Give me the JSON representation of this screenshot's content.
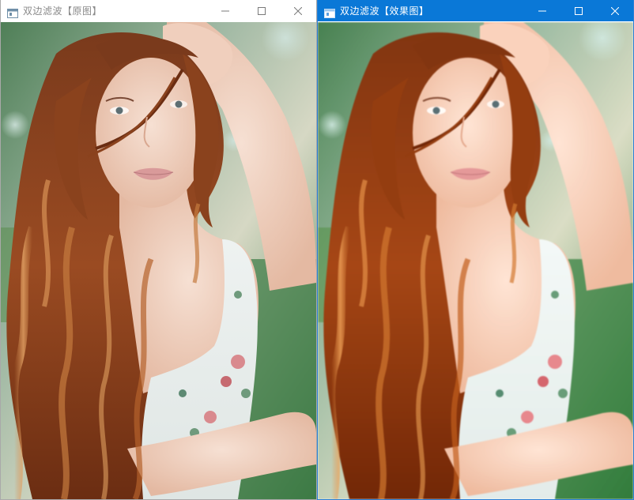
{
  "windows": [
    {
      "title": "双边滤波【原图】",
      "active": false,
      "controls": [
        "minimize-icon",
        "maximize-icon",
        "close-icon"
      ]
    },
    {
      "title": "双边滤波【效果图】",
      "active": true,
      "controls": [
        "minimize-icon",
        "maximize-icon",
        "close-icon"
      ]
    }
  ],
  "colors": {
    "active_titlebar": "#0a78d7",
    "inactive_titlebar": "#ffffff",
    "inactive_title_text": "#8a8a8a"
  }
}
